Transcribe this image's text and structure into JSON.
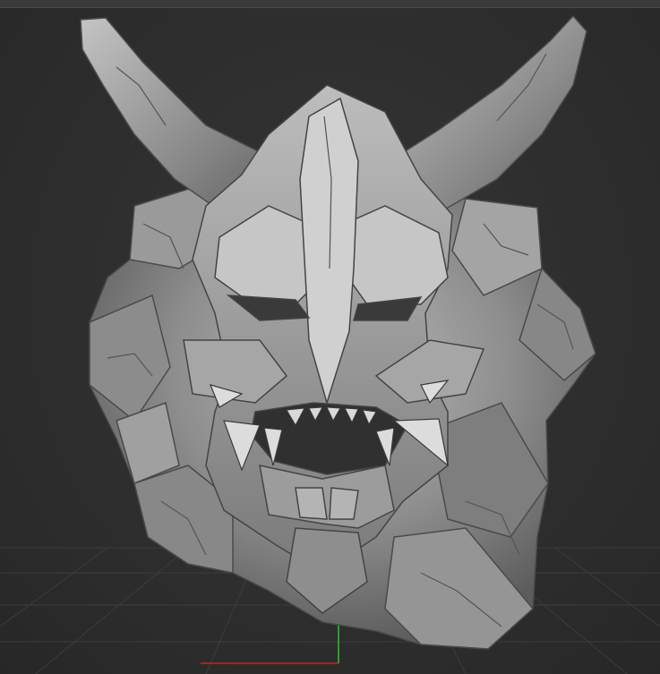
{
  "viewport": {
    "background_color": "#2f2f2f",
    "grid_color": "#3c3c3c",
    "axis_x_color": "#b02020",
    "axis_y_color": "#2aa02a",
    "subject": "sculpt-mesh"
  }
}
